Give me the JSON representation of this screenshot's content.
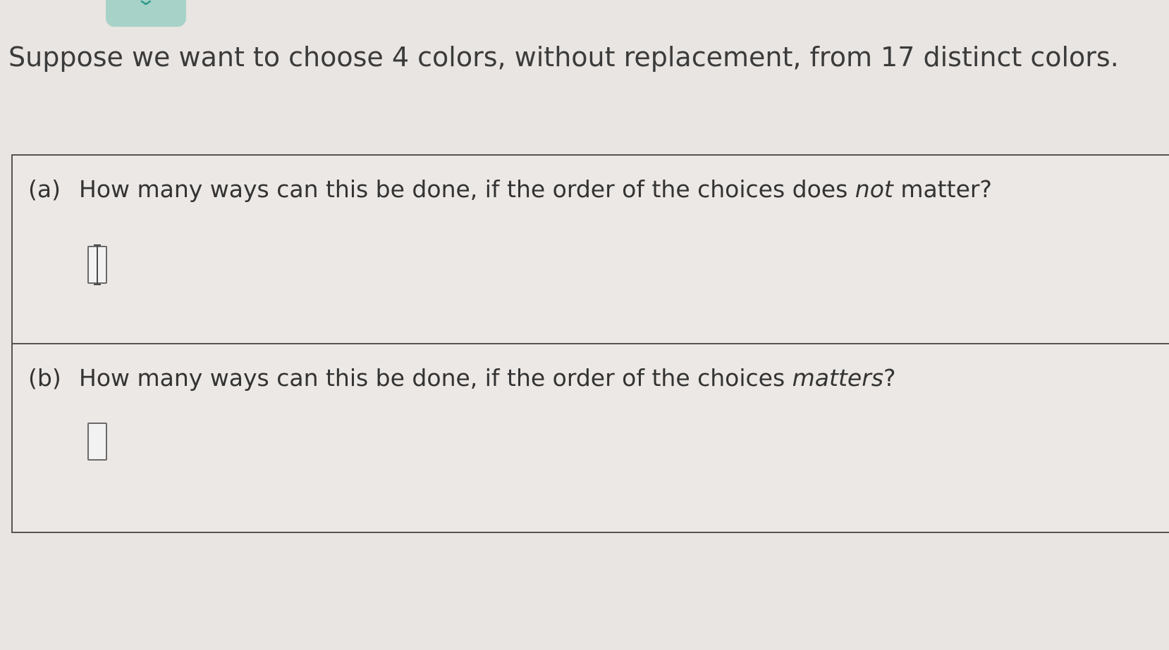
{
  "header": {
    "tab_icon": "chevron-down-icon"
  },
  "question": {
    "stem": "Suppose we want to choose 4 colors, without replacement, from 17 distinct colors."
  },
  "parts": [
    {
      "label": "(a)",
      "text_before": "How many ways can this be done, if the order of the choices does ",
      "emphasis": "not",
      "text_after": " matter?",
      "answer_value": ""
    },
    {
      "label": "(b)",
      "text_before": "How many ways can this be done, if the order of the choices ",
      "emphasis": "matters",
      "text_after": "?",
      "answer_value": ""
    }
  ]
}
